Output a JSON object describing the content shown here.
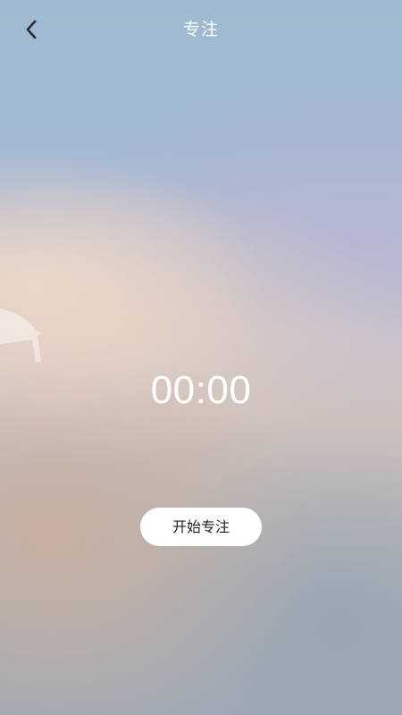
{
  "header": {
    "back_icon": "chevron-left-icon",
    "title": "专注"
  },
  "timer": {
    "value": "00:00"
  },
  "actions": {
    "start_label": "开始专注"
  },
  "colors": {
    "text_primary": "#ffffff",
    "button_bg": "#ffffff",
    "button_text": "#222222"
  }
}
